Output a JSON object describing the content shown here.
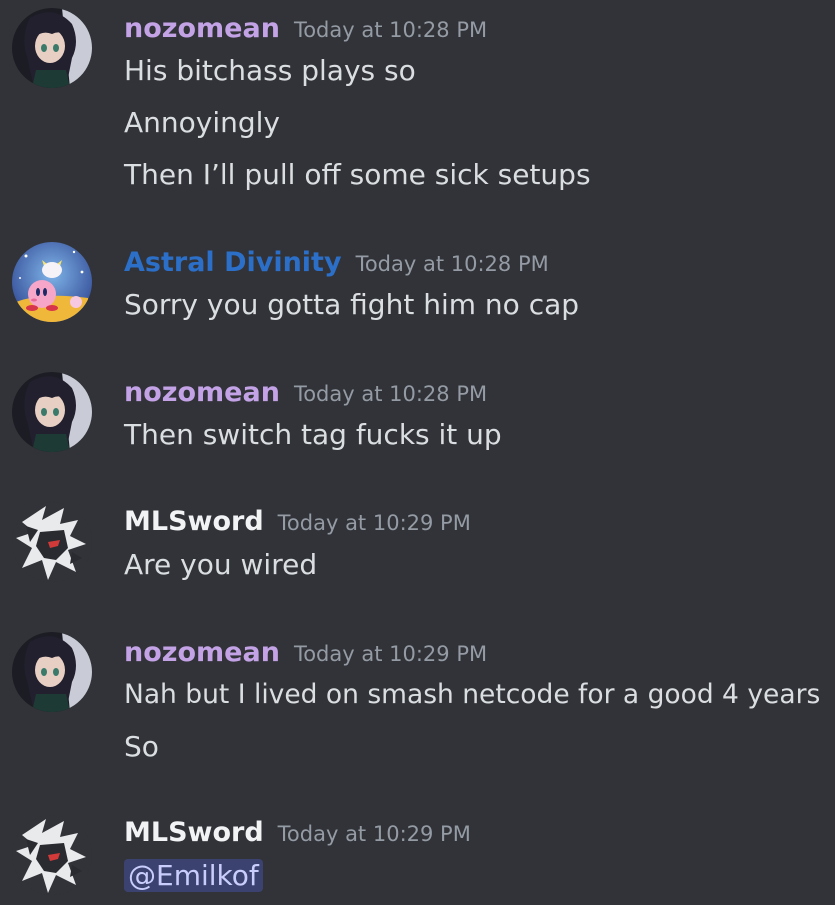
{
  "colors": {
    "background": "#313338",
    "message_text": "#dbdee1",
    "timestamp": "#949ba4",
    "user_purple": "#c3a2e6",
    "user_blue": "#2b6fc9",
    "user_white": "#f2f3f5",
    "mention_bg": "#3c4270",
    "mention_text": "#c9cdfb"
  },
  "messages": [
    {
      "author": "nozomean",
      "timestamp": "Today at 10:28 PM",
      "avatar_icon": "anime-girl-avatar-icon",
      "lines": [
        "His bitchass plays so",
        "Annoyingly",
        "Then I’ll pull off some sick setups"
      ]
    },
    {
      "author": "Astral Divinity",
      "timestamp": "Today at 10:28 PM",
      "avatar_icon": "kirby-avatar-icon",
      "lines": [
        "Sorry you gotta fight him no cap"
      ]
    },
    {
      "author": "nozomean",
      "timestamp": "Today at 10:28 PM",
      "avatar_icon": "anime-girl-avatar-icon",
      "lines": [
        "Then switch tag fucks it up"
      ]
    },
    {
      "author": "MLSword",
      "timestamp": "Today at 10:29 PM",
      "avatar_icon": "armored-knight-avatar-icon",
      "lines": [
        "Are you wired"
      ]
    },
    {
      "author": "nozomean",
      "timestamp": "Today at 10:29 PM",
      "avatar_icon": "anime-girl-avatar-icon",
      "lines": [
        "Nah but I lived on smash netcode for a good 4 years",
        "So"
      ]
    },
    {
      "author": "MLSword",
      "timestamp": "Today at 10:29 PM",
      "avatar_icon": "armored-knight-avatar-icon",
      "mention": "@Emilkof"
    }
  ]
}
